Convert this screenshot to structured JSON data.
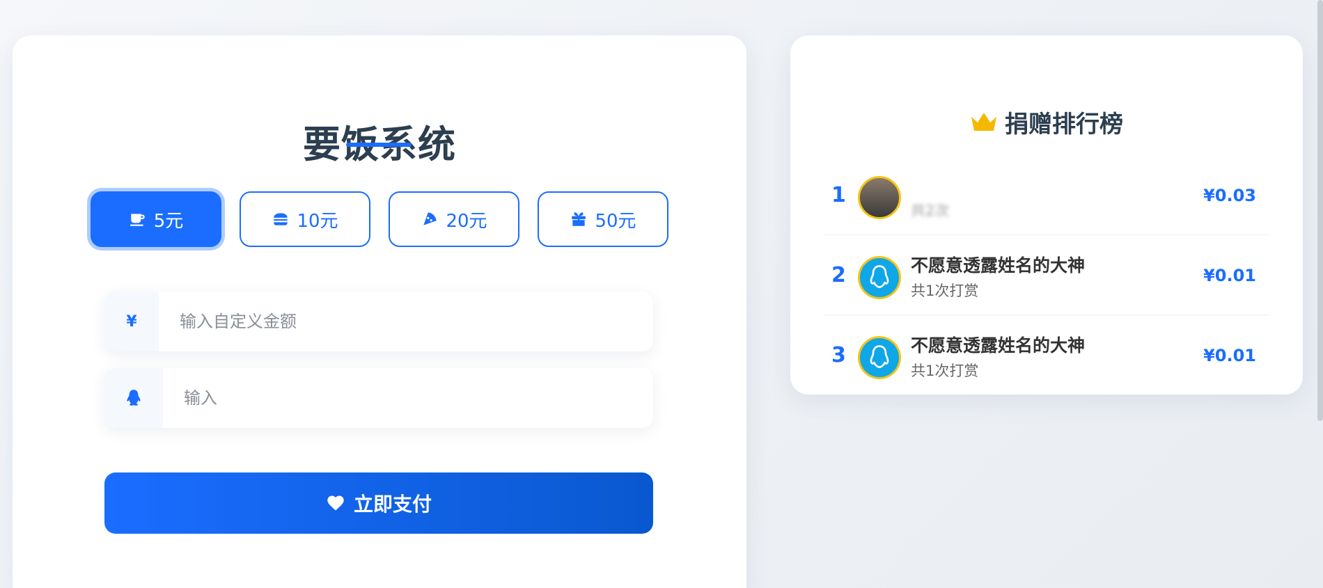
{
  "donate": {
    "title": "要饭系统",
    "amounts": [
      {
        "label": "5元",
        "icon": "coffee-icon",
        "active": true
      },
      {
        "label": "10元",
        "icon": "burger-icon",
        "active": false
      },
      {
        "label": "20元",
        "icon": "pizza-icon",
        "active": false
      },
      {
        "label": "50元",
        "icon": "gift-icon",
        "active": false
      }
    ],
    "custom_amount": {
      "prefix": "¥",
      "placeholder": "输入自定义金额",
      "value": ""
    },
    "qq_field": {
      "prefix_icon": "qq-icon",
      "placeholder": "输入",
      "value": ""
    },
    "pay_label": "立即支付",
    "accent_color": "#1a6dff"
  },
  "ranking": {
    "title": "捐赠排行榜",
    "items": [
      {
        "rank": "1",
        "name": "",
        "count": "共2次",
        "amount": "¥0.03",
        "avatar": "photo"
      },
      {
        "rank": "2",
        "name": "不愿意透露姓名的大神",
        "count": "共1次打赏",
        "amount": "¥0.01",
        "avatar": "qq"
      },
      {
        "rank": "3",
        "name": "不愿意透露姓名的大神",
        "count": "共1次打赏",
        "amount": "¥0.01",
        "avatar": "qq"
      }
    ]
  }
}
